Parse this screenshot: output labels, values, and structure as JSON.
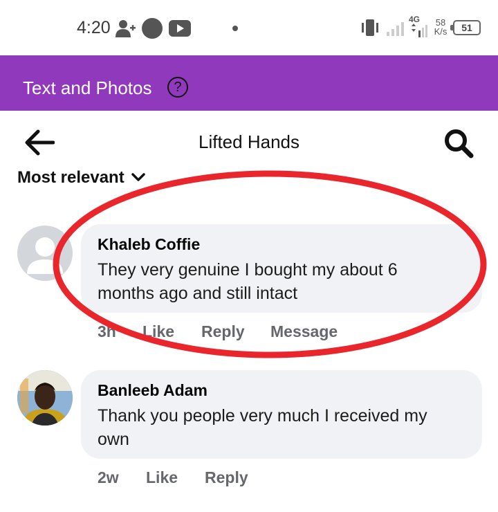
{
  "status_bar": {
    "time": "4:20",
    "network_type": "4G",
    "speed_value": "58",
    "speed_unit": "K/s",
    "battery": "51"
  },
  "app_header": {
    "title": "Text and Photos",
    "help_symbol": "?"
  },
  "nav": {
    "title": "Lifted Hands"
  },
  "sort": {
    "label": "Most relevant"
  },
  "comments": [
    {
      "author": "Khaleb Coffie",
      "text_line1": "They very genuine I bought my about 6",
      "text_line2": "months ago and still intact",
      "time": "3h",
      "like": "Like",
      "reply": "Reply",
      "message": "Message"
    },
    {
      "author": "Banleeb Adam",
      "text_line1": "Thank you people very much I received my",
      "text_line2": "own",
      "time": "2w",
      "like": "Like",
      "reply": "Reply"
    }
  ],
  "colors": {
    "header_purple": "#9139bd",
    "bubble_bg": "#f0f2f5",
    "annotation_red": "#e8262b",
    "action_gray": "#65676b"
  }
}
